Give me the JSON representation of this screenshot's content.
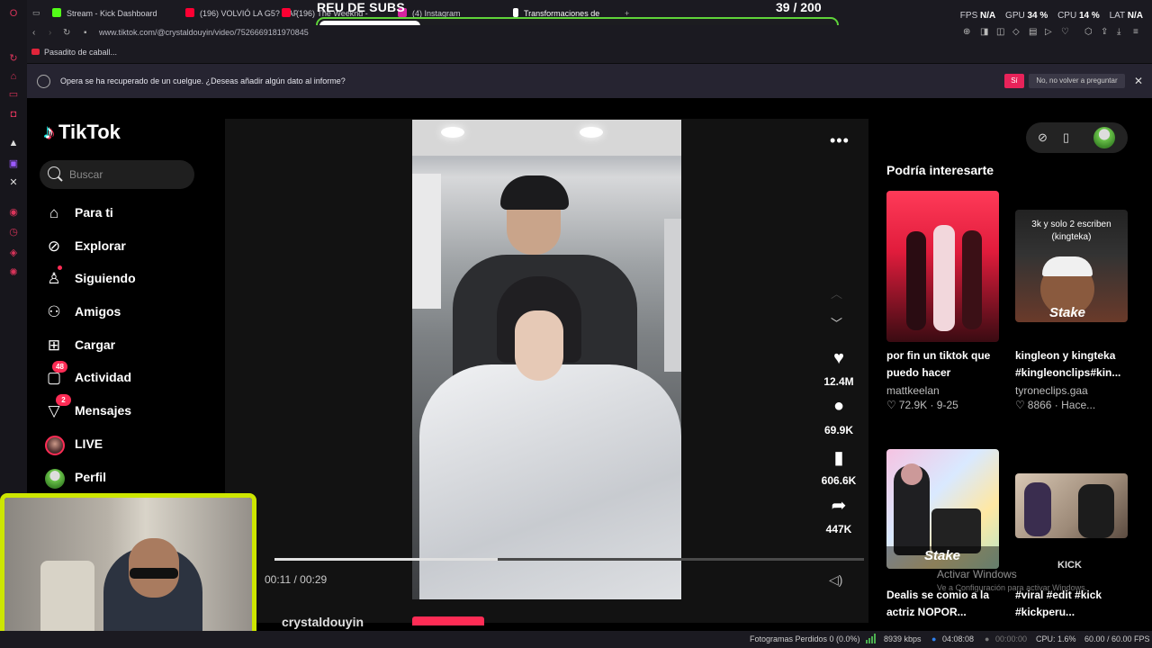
{
  "tabs": [
    {
      "label": "Stream - Kick Dashboard",
      "color": "#53fc18"
    },
    {
      "label": "(196) VOLVIÓ LA G5? CAF",
      "color": "#ff0033"
    },
    {
      "label": "(196) The Weeknd -",
      "color": "#ff0033"
    },
    {
      "label": "(4) Instagram",
      "color": "#d6249f"
    },
    {
      "label": "Transformaciones de",
      "color": "#ffffff"
    }
  ],
  "overlay": {
    "title": "REU DE SUBS",
    "count": "39 / 200",
    "progress": 0.195
  },
  "perf": {
    "fps_label": "FPS",
    "fps_value": "N/A",
    "gpu_label": "GPU",
    "gpu_value": "34 %",
    "cpu_label": "CPU",
    "cpu_value": "14 %",
    "lat_label": "LAT",
    "lat_value": "N/A"
  },
  "address": {
    "url": "www.tiktok.com/@crystaldouyin/video/7526669181970845"
  },
  "bookmark": {
    "label": "Pasadito de caball..."
  },
  "crash_bar": {
    "message": "Opera se ha recuperado de un cuelgue. ¿Deseas añadir algún dato al informe?",
    "yes": "Sí",
    "no": "No, no volver a preguntar",
    "close": "✕"
  },
  "tiktok": {
    "logo": "TikTok",
    "search_placeholder": "Buscar",
    "nav": [
      {
        "label": "Para ti",
        "icon": "home-icon"
      },
      {
        "label": "Explorar",
        "icon": "compass-icon"
      },
      {
        "label": "Siguiendo",
        "icon": "following-icon"
      },
      {
        "label": "Amigos",
        "icon": "friends-icon"
      },
      {
        "label": "Cargar",
        "icon": "upload-icon"
      },
      {
        "label": "Actividad",
        "icon": "inbox-icon",
        "badge": "48"
      },
      {
        "label": "Mensajes",
        "icon": "send-icon",
        "badge": "2"
      },
      {
        "label": "LIVE",
        "icon": "live-avatar"
      },
      {
        "label": "Perfil",
        "icon": "profile-avatar"
      }
    ],
    "video": {
      "time": "00:11 / 00:29",
      "progress": 0.379,
      "author": "crystaldouyin",
      "likes": "12.4M",
      "comments": "69.9K",
      "saves": "606.6K",
      "shares": "447K"
    },
    "suggest_title": "Podría interesarte",
    "cards": [
      {
        "title": "por fin un tiktok que puedo hacer",
        "user": "mattkeelan",
        "likes": "72.9K",
        "date": "9-25"
      },
      {
        "title": "kingleon y kingteka #kingleonclips#kin...",
        "user": "tyroneclips.gaa",
        "likes": "8866",
        "date": "Hace...",
        "overlay": "3k y solo 2 escriben (kingteka)"
      },
      {
        "title": "Dealis se comio a la actriz NOPOR...",
        "user": "",
        "likes": "",
        "date": ""
      },
      {
        "title": "#viral #edit #kick #kickperu...",
        "user": "",
        "likes": "",
        "date": ""
      }
    ],
    "stake_label": "Stake",
    "kick_label": "KICK"
  },
  "windows": {
    "activate": "Activar Windows",
    "activate_sub": "Ve a Configuración para activar Windows."
  },
  "status": {
    "frames": "Fotogramas Perdidos 0 (0.0%)",
    "kbps": "8939 kbps",
    "time1": "04:08:08",
    "time2": "00:00:00",
    "cpu": "CPU: 1.6%",
    "fps": "60.00 / 60.00 FPS"
  },
  "colors": {
    "accent": "#fe2c55",
    "kick_green": "#5fd43a",
    "cam_border": "#cde600"
  }
}
